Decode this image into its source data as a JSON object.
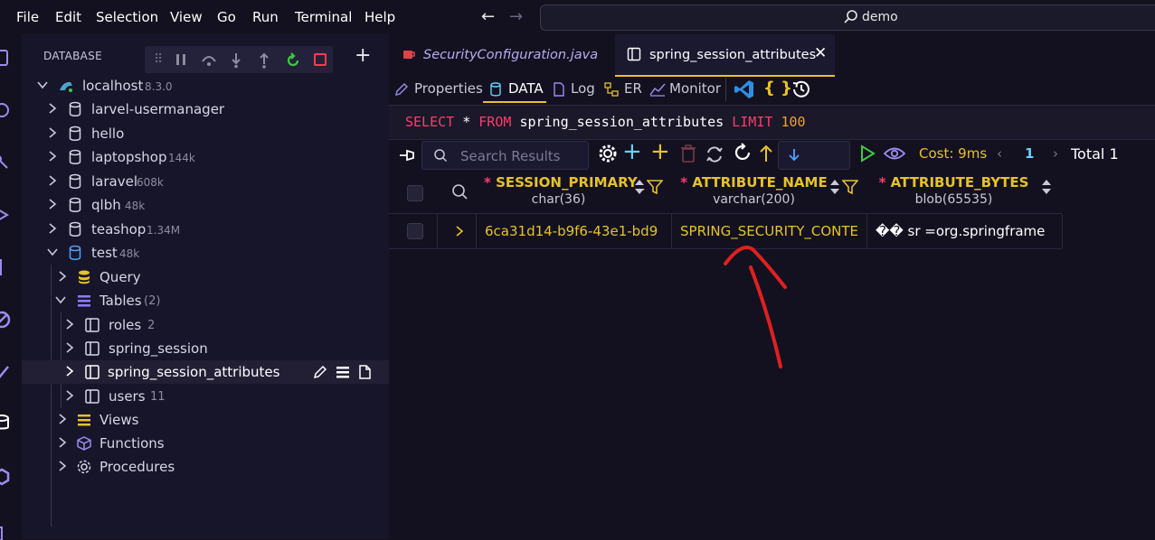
{
  "menu": [
    "File",
    "Edit",
    "Selection",
    "View",
    "Go",
    "Run",
    "Terminal",
    "Help"
  ],
  "command_center": "demo",
  "sidebar": {
    "title": "DATABASE",
    "connection": {
      "label": "localhost",
      "version": "8.3.0"
    },
    "databases": [
      {
        "label": "larvel-usermanager",
        "size": ""
      },
      {
        "label": "hello",
        "size": ""
      },
      {
        "label": "laptopshop",
        "size": "144k"
      },
      {
        "label": "laravel",
        "size": "608k"
      },
      {
        "label": "qlbh",
        "size": "48k"
      },
      {
        "label": "teashop",
        "size": "1.34M"
      },
      {
        "label": "test",
        "size": "48k"
      }
    ],
    "test_children": {
      "query": "Query",
      "tables": "Tables",
      "tables_count": "(2)",
      "table_items": [
        {
          "label": "roles",
          "count": "2"
        },
        {
          "label": "spring_session",
          "count": ""
        },
        {
          "label": "spring_session_attributes",
          "count": ""
        },
        {
          "label": "users",
          "count": "11"
        }
      ],
      "views": "Views",
      "functions": "Functions",
      "procedures": "Procedures"
    }
  },
  "tabs": [
    {
      "label": "SecurityConfiguration.java",
      "active": false
    },
    {
      "label": "spring_session_attributes",
      "active": true
    }
  ],
  "subtabs": [
    "Properties",
    "DATA",
    "Log",
    "ER",
    "Monitor"
  ],
  "sql": {
    "select": "SELECT",
    "star": "*",
    "from": "FROM",
    "table": "spring_session_attributes",
    "limit": "LIMIT",
    "n": "100"
  },
  "results_toolbar": {
    "search_placeholder": "Search Results",
    "cost": "Cost: 9ms",
    "page": "1",
    "total": "Total 1"
  },
  "columns": [
    {
      "name": "SESSION_PRIMARY_",
      "type": "char(36)"
    },
    {
      "name": "ATTRIBUTE_NAME",
      "type": "varchar(200)"
    },
    {
      "name": "ATTRIBUTE_BYTES",
      "type": "blob(65535)"
    }
  ],
  "rows": [
    {
      "cells": [
        "6ca31d14-b9f6-43e1-bd9",
        "SPRING_SECURITY_CONTE",
        "�� \u0005sr =org.springframe"
      ]
    }
  ],
  "colors": {
    "accent": "#e6c229",
    "keyword": "#ff3b6b",
    "annotation": "#e02020"
  }
}
